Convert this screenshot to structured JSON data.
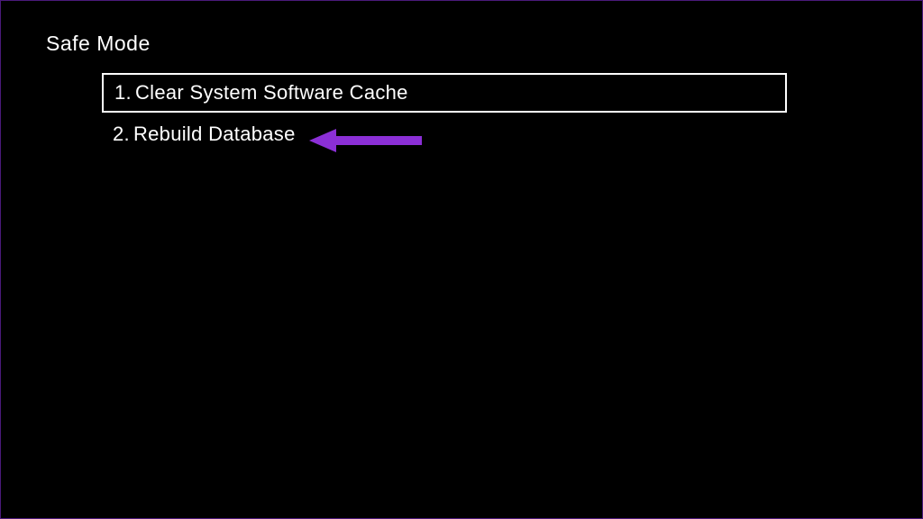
{
  "title": "Safe Mode",
  "menu": {
    "items": [
      {
        "number": "1.",
        "label": "Clear System Software Cache",
        "selected": true
      },
      {
        "number": "2.",
        "label": "Rebuild Database",
        "selected": false
      }
    ]
  },
  "annotation": {
    "arrow_color": "#8b2fd6",
    "border_color": "#4a1a7a"
  }
}
